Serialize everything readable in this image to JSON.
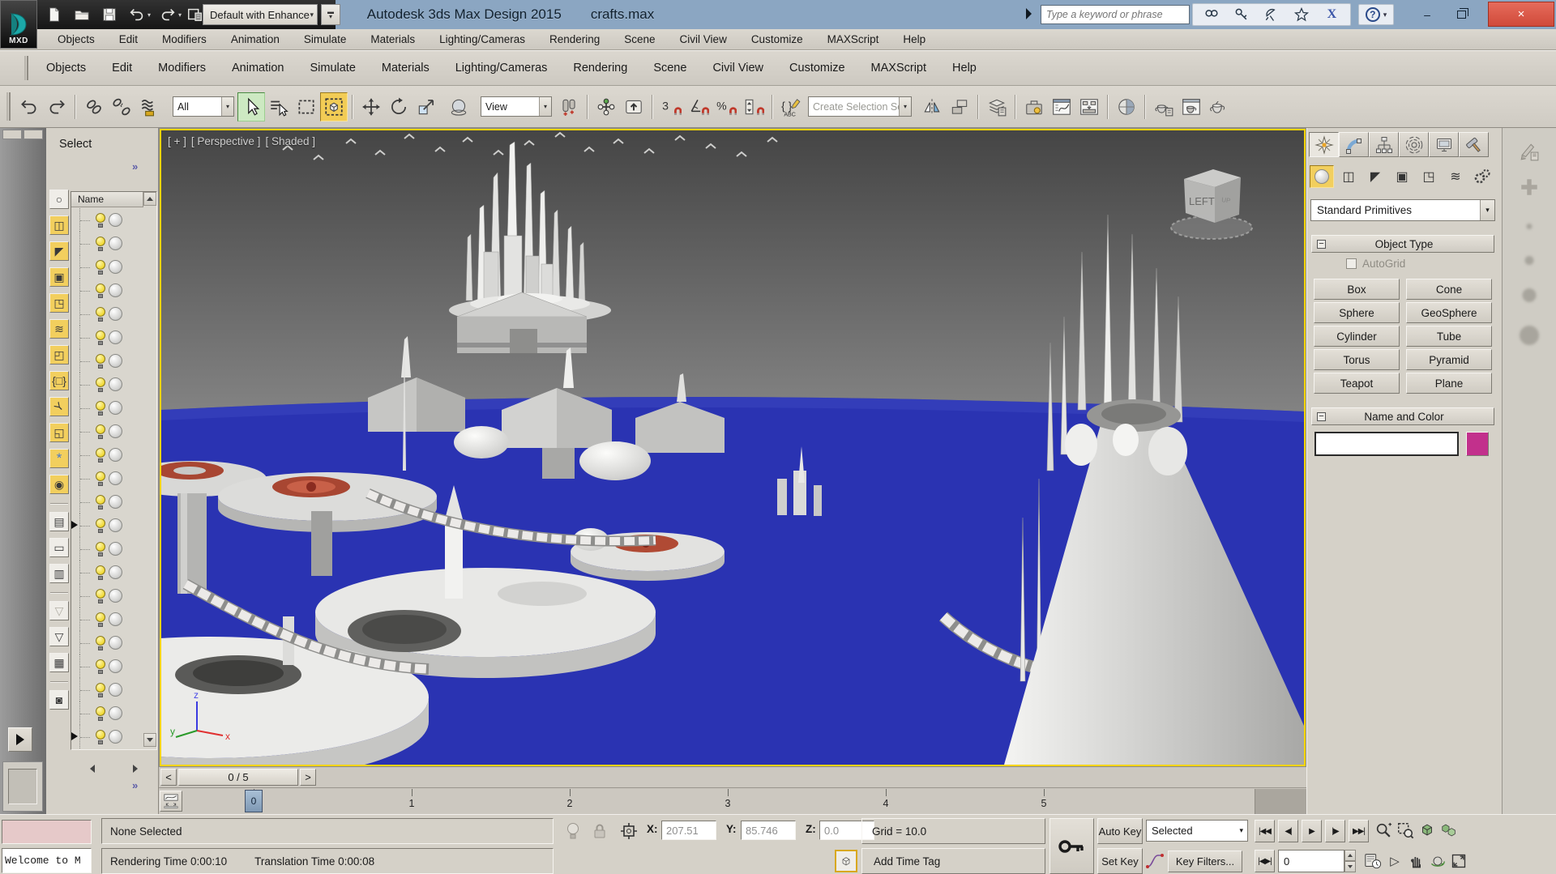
{
  "app": {
    "title": "Autodesk 3ds Max Design 2015",
    "filename": "crafts.max",
    "logo_text": "MXD"
  },
  "titlebar": {
    "workspace": "Default with Enhance",
    "search_placeholder": "Type a keyword or phrase",
    "help_glyph": "?",
    "minimize_glyph": "–",
    "close_glyph": "×",
    "exchange_glyph": "X"
  },
  "menu_items": [
    "Objects",
    "Edit",
    "Modifiers",
    "Animation",
    "Simulate",
    "Materials",
    "Lighting/Cameras",
    "Rendering",
    "Scene",
    "Civil View",
    "Customize",
    "MAXScript",
    "Help"
  ],
  "toolbar": {
    "selection_filter": "All",
    "coord_system": "View",
    "named_sets_placeholder": "Create Selection Se",
    "snap_label": "3",
    "icons": [
      "undo",
      "redo",
      "select-link",
      "unlink-selection",
      "bind-to-space-warp",
      "select-object",
      "select-by-name",
      "rectangular-selection-region",
      "window-crossing",
      "select-and-move",
      "select-and-rotate",
      "select-and-scale",
      "select-and-place",
      "use-pivot-point-center",
      "select-and-manipulate",
      "keyboard-shortcut-override",
      "snaps-toggle",
      "angle-snap",
      "percent-snap",
      "spinner-snap",
      "edit-named-selection-sets",
      "mirror",
      "align",
      "layer-manager",
      "scene-states",
      "curve-editor",
      "schematic-view",
      "material-editor",
      "render-setup",
      "rendered-frame-window",
      "render-production"
    ]
  },
  "explorer": {
    "title": "Select",
    "expand_glyph": "»",
    "name_column": "Name",
    "row_count": 23,
    "arrow_rows": [
      13,
      22
    ],
    "prev_glyph": "<",
    "next_glyph": ">"
  },
  "viewport": {
    "label_general": "[ + ]",
    "label_pov": "[ Perspective ]",
    "label_shading": "[ Shaded ]",
    "viewcube_face": "LEFT",
    "axis_x": "x",
    "axis_y": "y",
    "axis_z": "z"
  },
  "time_slider": {
    "value": "0 / 5"
  },
  "track_bar": {
    "ticks": [
      "0",
      "1",
      "2",
      "3",
      "4",
      "5"
    ],
    "current_frame": "0"
  },
  "command_panel": {
    "category": "Standard Primitives",
    "object_type_title": "Object Type",
    "autogrid_label": "AutoGrid",
    "object_buttons": [
      "Box",
      "Cone",
      "Sphere",
      "GeoSphere",
      "Cylinder",
      "Tube",
      "Torus",
      "Pyramid",
      "Teapot",
      "Plane"
    ],
    "name_color_title": "Name and Color",
    "object_name_value": "",
    "color_swatch": "#c2308c"
  },
  "status": {
    "selection": "None Selected",
    "listener_text": "Welcome to M",
    "coord_x_label": "X:",
    "coord_x": "207.51",
    "coord_y_label": "Y:",
    "coord_y": "85.746",
    "coord_z_label": "Z:",
    "coord_z": "0.0",
    "grid": "Grid = 10.0",
    "rendering_time": "Rendering Time  0:00:10",
    "translation_time": "Translation Time  0:00:08",
    "add_time_tag": "Add Time Tag",
    "auto_key": "Auto Key",
    "set_key": "Set Key",
    "key_filters": "Key Filters...",
    "key_mode_dropdown": "Selected",
    "frame_field": "0",
    "transport": [
      {
        "name": "go-to-start",
        "glyph": "|◀◀"
      },
      {
        "name": "previous-frame",
        "glyph": "◀|"
      },
      {
        "name": "play",
        "glyph": "▶"
      },
      {
        "name": "next-frame",
        "glyph": "|▶"
      },
      {
        "name": "go-to-end",
        "glyph": "▶▶|"
      }
    ],
    "key_step_glyph": "|◀▶|"
  }
}
